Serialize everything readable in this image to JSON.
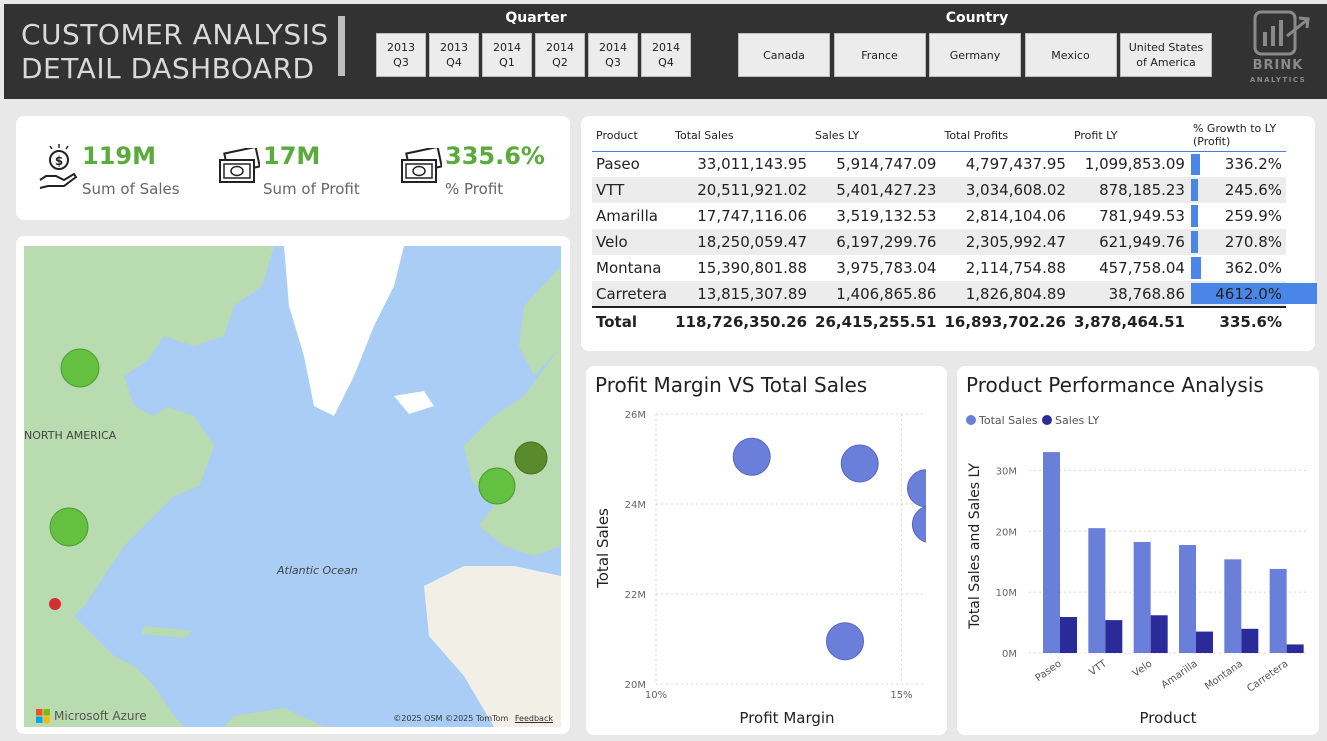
{
  "header": {
    "title": "CUSTOMER ANALYSIS\nDETAIL DASHBOARD",
    "quarter_label": "Quarter",
    "quarters": [
      "2013\nQ3",
      "2013\nQ4",
      "2014\nQ1",
      "2014\nQ2",
      "2014\nQ3",
      "2014\nQ4"
    ],
    "country_label": "Country",
    "countries": [
      "Canada",
      "France",
      "Germany",
      "Mexico",
      "United States\nof America"
    ],
    "logo_text": "BRINK",
    "logo_sub": "ANALYTICS"
  },
  "kpis": [
    {
      "value": "119M",
      "label": "Sum of Sales",
      "icon": "money-hand-icon"
    },
    {
      "value": "17M",
      "label": "Sum of Profit",
      "icon": "cash-icon"
    },
    {
      "value": "335.6%",
      "label": "% Profit",
      "icon": "cash-icon"
    }
  ],
  "map": {
    "label_north_america": "NORTH AMERICA",
    "label_ocean": "Atlantic Ocean",
    "brand": "Microsoft Azure",
    "attribution": "©2025 OSM  ©2025 TomTom",
    "feedback": "Feedback",
    "colors": {
      "water": "#a9cdf5",
      "land": "#b9dbb0",
      "bubble": "#64c040",
      "bubble_dark": "#5b8a2c",
      "marker": "#d32f2f"
    }
  },
  "table": {
    "columns": [
      "Product",
      "Total Sales",
      "Sales LY",
      "Total Profits",
      "Profit LY",
      "% Growth to LY (Profit)"
    ],
    "rows": [
      {
        "product": "Paseo",
        "sales": "33,011,143.95",
        "sales_ly": "5,914,747.09",
        "profits": "4,797,437.95",
        "profit_ly": "1,099,853.09",
        "growth": "336.2%",
        "growth_pct": 336.2
      },
      {
        "product": "VTT",
        "sales": "20,511,921.02",
        "sales_ly": "5,401,427.23",
        "profits": "3,034,608.02",
        "profit_ly": "878,185.23",
        "growth": "245.6%",
        "growth_pct": 245.6
      },
      {
        "product": "Amarilla",
        "sales": "17,747,116.06",
        "sales_ly": "3,519,132.53",
        "profits": "2,814,104.06",
        "profit_ly": "781,949.53",
        "growth": "259.9%",
        "growth_pct": 259.9
      },
      {
        "product": "Velo",
        "sales": "18,250,059.47",
        "sales_ly": "6,197,299.76",
        "profits": "2,305,992.47",
        "profit_ly": "621,949.76",
        "growth": "270.8%",
        "growth_pct": 270.8
      },
      {
        "product": "Montana",
        "sales": "15,390,801.88",
        "sales_ly": "3,975,783.04",
        "profits": "2,114,754.88",
        "profit_ly": "457,758.04",
        "growth": "362.0%",
        "growth_pct": 362.0
      },
      {
        "product": "Carretera",
        "sales": "13,815,307.89",
        "sales_ly": "1,406,865.86",
        "profits": "1,826,804.89",
        "profit_ly": "38,768.86",
        "growth": "4612.0%",
        "growth_pct": 4612.0
      }
    ],
    "total": {
      "product": "Total",
      "sales": "118,726,350.26",
      "sales_ly": "26,415,255.51",
      "profits": "16,893,702.26",
      "profit_ly": "3,878,464.51",
      "growth": "335.6%"
    },
    "bar_color": "#4a86e8"
  },
  "chart_data": [
    {
      "type": "scatter",
      "title": "Profit Margin VS Total Sales",
      "xlabel": "Profit Margin",
      "ylabel": "Total Sales",
      "xlim": [
        0.1,
        0.155
      ],
      "ylim": [
        20000000,
        26000000
      ],
      "xticks": [
        {
          "v": 0.1,
          "label": "10%"
        },
        {
          "v": 0.15,
          "label": "15%"
        }
      ],
      "yticks": [
        {
          "v": 20000000,
          "label": "20M"
        },
        {
          "v": 22000000,
          "label": "22M"
        },
        {
          "v": 24000000,
          "label": "24M"
        },
        {
          "v": 26000000,
          "label": "26M"
        }
      ],
      "color": "#6a7fd9",
      "points": [
        {
          "x": 0.1195,
          "y": 25050000
        },
        {
          "x": 0.1415,
          "y": 24900000
        },
        {
          "x": 0.155,
          "y": 24350000
        },
        {
          "x": 0.156,
          "y": 23550000
        },
        {
          "x": 0.1385,
          "y": 20950000
        }
      ]
    },
    {
      "type": "bar",
      "title": "Product Performance Analysis",
      "xlabel": "Product",
      "ylabel": "Total Sales and Sales LY",
      "ylim": [
        0,
        35000000
      ],
      "yticks": [
        {
          "v": 0,
          "label": "0M"
        },
        {
          "v": 10000000,
          "label": "10M"
        },
        {
          "v": 20000000,
          "label": "20M"
        },
        {
          "v": 30000000,
          "label": "30M"
        }
      ],
      "categories": [
        "Paseo",
        "VTT",
        "Velo",
        "Amarilla",
        "Montana",
        "Carretera"
      ],
      "series": [
        {
          "name": "Total Sales",
          "color": "#6a7fd9",
          "values": [
            33011143.95,
            20511921.02,
            18250059.47,
            17747116.06,
            15390801.88,
            13815307.89
          ]
        },
        {
          "name": "Sales LY",
          "color": "#2a2a9a",
          "values": [
            5914747.09,
            5401427.23,
            6197299.76,
            3519132.53,
            3975783.04,
            1406865.86
          ]
        }
      ]
    }
  ]
}
